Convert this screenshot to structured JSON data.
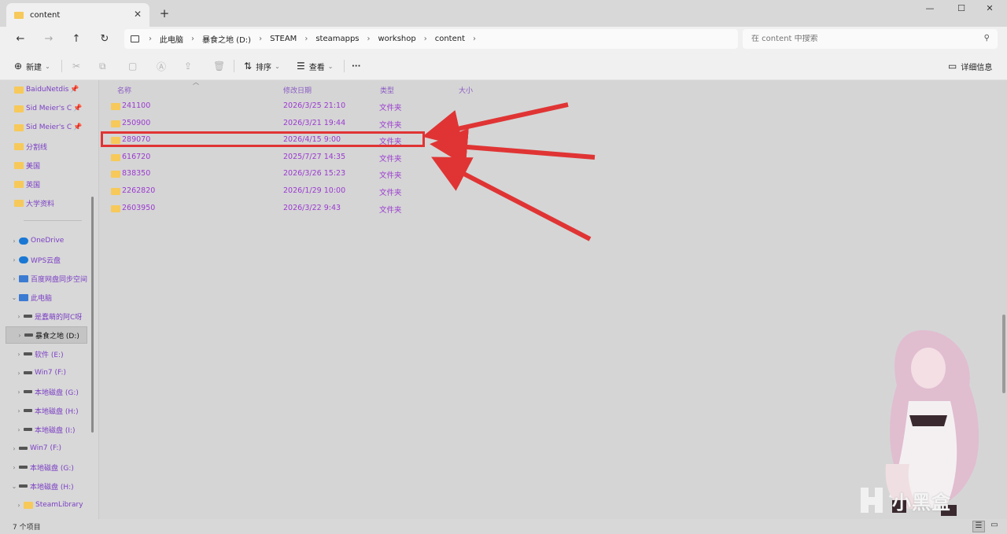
{
  "tab": {
    "title": "content",
    "close": "✕",
    "new": "+"
  },
  "window": {
    "minimize": "—",
    "maximize": "☐",
    "close": "✕"
  },
  "nav": {
    "back": "←",
    "forward": "→",
    "up": "↑",
    "refresh": "↻"
  },
  "address": {
    "crumbs": [
      "此电脑",
      "暴食之地 (D:)",
      "STEAM",
      "steamapps",
      "workshop",
      "content"
    ]
  },
  "search": {
    "placeholder": "在 content 中搜索"
  },
  "commands": {
    "new_label": "新建",
    "sort_label": "排序",
    "view_label": "查看",
    "more_label": "···",
    "details_label": "详细信息"
  },
  "sidebar": {
    "quick_items": [
      {
        "label": "BaiduNetdis",
        "pinned": true
      },
      {
        "label": "Sid Meier's C",
        "pinned": true
      },
      {
        "label": "Sid Meier's C",
        "pinned": true
      },
      {
        "label": "分割线"
      },
      {
        "label": "美国"
      },
      {
        "label": "英国"
      },
      {
        "label": "大学资料"
      }
    ],
    "tree_items": [
      {
        "label": "OneDrive",
        "icon": "cloud-icon",
        "chev": "›"
      },
      {
        "label": "WPS云盘",
        "icon": "cloud-icon",
        "chev": "›"
      },
      {
        "label": "百度网盘同步空间",
        "icon": "sync-icon",
        "chev": "›"
      },
      {
        "label": "此电脑",
        "icon": "pc-icon",
        "chev": "⌄"
      },
      {
        "label": "是蠢萌的阿C呀",
        "icon": "drive-icon",
        "chev": "›"
      },
      {
        "label": "暴食之地 (D:)",
        "icon": "drive-icon",
        "chev": "›",
        "selected": true
      },
      {
        "label": "软件 (E:)",
        "icon": "drive-icon",
        "chev": "›"
      },
      {
        "label": "Win7 (F:)",
        "icon": "drive-icon",
        "chev": "›"
      },
      {
        "label": "本地磁盘 (G:)",
        "icon": "drive-icon",
        "chev": "›"
      },
      {
        "label": "本地磁盘 (H:)",
        "icon": "drive-icon",
        "chev": "›"
      },
      {
        "label": "本地磁盘 (I:)",
        "icon": "drive-icon",
        "chev": "›"
      },
      {
        "label": "Win7 (F:)",
        "icon": "drive-icon",
        "chev": "›"
      },
      {
        "label": "本地磁盘 (G:)",
        "icon": "drive-icon",
        "chev": "›"
      },
      {
        "label": "本地磁盘 (H:)",
        "icon": "drive-icon",
        "chev": "⌄"
      },
      {
        "label": "SteamLibrary",
        "icon": "folder-icon",
        "chev": "›"
      }
    ]
  },
  "list": {
    "columns": {
      "name": "名称",
      "date": "修改日期",
      "type": "类型",
      "size": "大小"
    },
    "rows": [
      {
        "name": "241100",
        "date": "2026/3/25 21:10",
        "type": "文件夹"
      },
      {
        "name": "250900",
        "date": "2026/3/21 19:44",
        "type": "文件夹"
      },
      {
        "name": "289070",
        "date": "2026/4/15 9:00",
        "type": "文件夹"
      },
      {
        "name": "616720",
        "date": "2025/7/27 14:35",
        "type": "文件夹"
      },
      {
        "name": "838350",
        "date": "2026/3/26 15:23",
        "type": "文件夹"
      },
      {
        "name": "2262820",
        "date": "2026/1/29 10:00",
        "type": "文件夹"
      },
      {
        "name": "2603950",
        "date": "2026/3/22 9:43",
        "type": "文件夹"
      }
    ],
    "highlighted_row": 2
  },
  "status": {
    "count": "7 个项目"
  },
  "watermark": {
    "text": "小黑盒"
  },
  "colors": {
    "annotation_red": "#e03434",
    "list_text": "#9b3ad0",
    "folder": "#f6c95a"
  }
}
